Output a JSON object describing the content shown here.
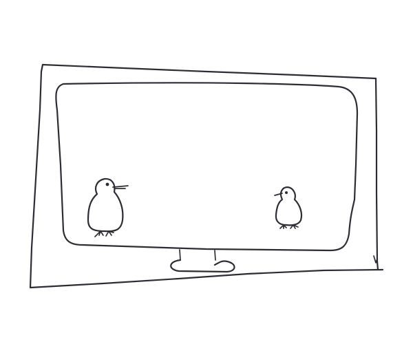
{
  "drawing": {
    "style": "pencil sketch",
    "ink_color": "#2c2c34",
    "paper_color": "#ffffff",
    "subjects": [
      "outer-frame",
      "monitor-screen",
      "monitor-stand",
      "bird-left",
      "bird-right"
    ]
  }
}
